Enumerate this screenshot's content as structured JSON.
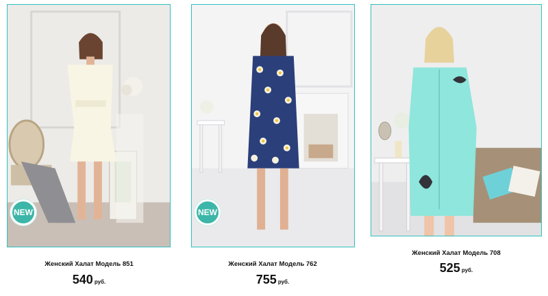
{
  "products": [
    {
      "title": "Женский Халат Модель 851",
      "price": "540",
      "currency": "руб.",
      "badge": "NEW",
      "robe": "cream"
    },
    {
      "title": "Женский Халат Модель 762",
      "price": "755",
      "currency": "руб.",
      "badge": "NEW",
      "robe": "navy-daisy"
    },
    {
      "title": "Женский Халат Модель 708",
      "price": "525",
      "currency": "руб.",
      "badge": "",
      "robe": "mint"
    }
  ],
  "colors": {
    "frame": "#2fbfbf",
    "badge": "#3cb6a8",
    "text": "#111111"
  }
}
